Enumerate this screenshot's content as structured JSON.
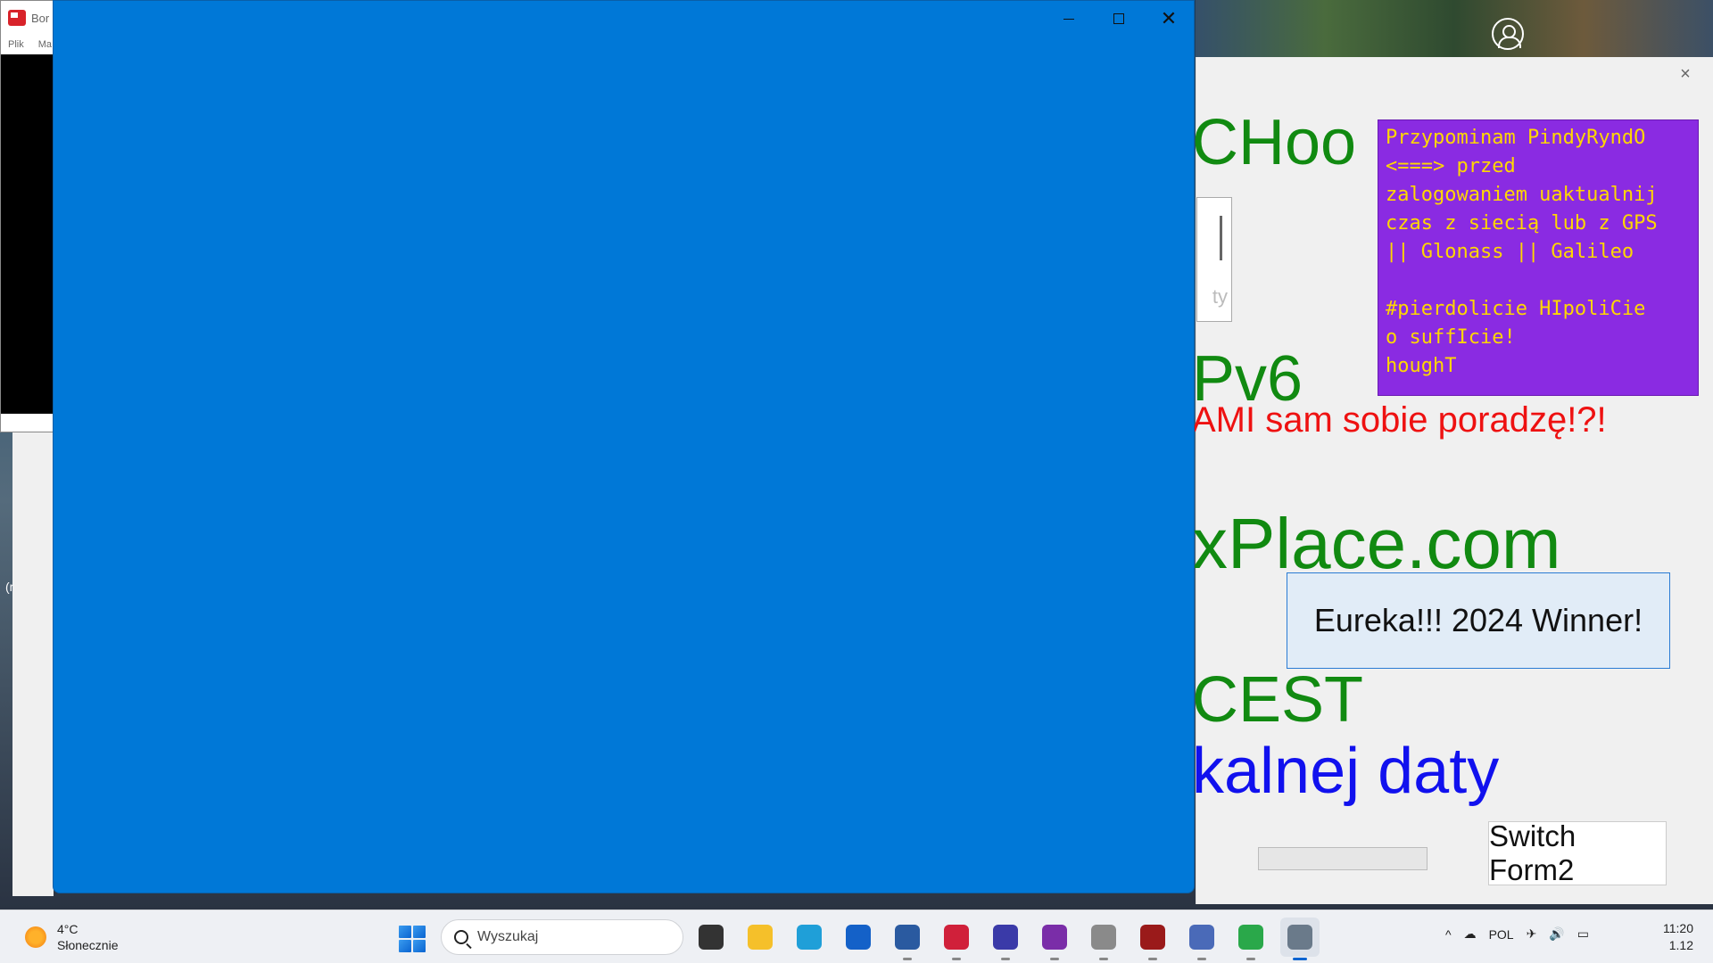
{
  "background_app": {
    "title": "Bor",
    "menu": [
      "Plik",
      "Ma"
    ],
    "side_text": "(r"
  },
  "form2": {
    "close_glyph": "×",
    "label_chooser": "CHoo",
    "label_ipv6": "Pv6",
    "label_sami": "AMI sam sobie poradzę!?!",
    "label_place": "xPlace.com",
    "label_cest": "CEST",
    "label_daty": "kalnej daty",
    "scrollbox_text": "ty",
    "note": "Przypominam PindyRyndO\n<===> przed\nzalogowaniem uaktualnij\nczas z siecią lub z GPS\n|| Glonass || Galileo\n\n#pierdolicie HIpoliCie\no suffIcie!\nhoughT",
    "eureka_button": "Eureka!!! 2024 Winner!",
    "switch_button": "Switch Form2",
    "progress_value": 0
  },
  "blue_window": {
    "minimize": "",
    "maximize": "",
    "close": "✕"
  },
  "taskbar": {
    "weather_temp": "4°C",
    "weather_desc": "Słonecznie",
    "search_placeholder": "Wyszukaj",
    "apps": [
      {
        "name": "task-view",
        "color": "#333333"
      },
      {
        "name": "file-explorer",
        "color": "#f5c02a"
      },
      {
        "name": "edge",
        "color": "#1f9fd8"
      },
      {
        "name": "store",
        "color": "#1461c8"
      },
      {
        "name": "virtualbox",
        "color": "#2a5aa0"
      },
      {
        "name": "red-app",
        "color": "#d0203a"
      },
      {
        "name": "floppy-save",
        "color": "#3a3aa8"
      },
      {
        "name": "github-desktop",
        "color": "#7a2da8"
      },
      {
        "name": "disk-app",
        "color": "#8a8a8a"
      },
      {
        "name": "d-app",
        "color": "#9a1a1a"
      },
      {
        "name": "network-app",
        "color": "#4a6ab8"
      },
      {
        "name": "globe-app",
        "color": "#2aa84a"
      },
      {
        "name": "settings",
        "color": "#6a7a8a"
      }
    ],
    "tray_chevron": "^",
    "tray_language": "POL",
    "clock_time": "11:20",
    "clock_date": "1.12"
  },
  "colors": {
    "blue_window": "#0078d7",
    "green_text": "#118a11",
    "red_text": "#ee1111",
    "blue_text": "#1111ee",
    "note_bg": "#8a2be2",
    "note_text": "#ffd700"
  }
}
